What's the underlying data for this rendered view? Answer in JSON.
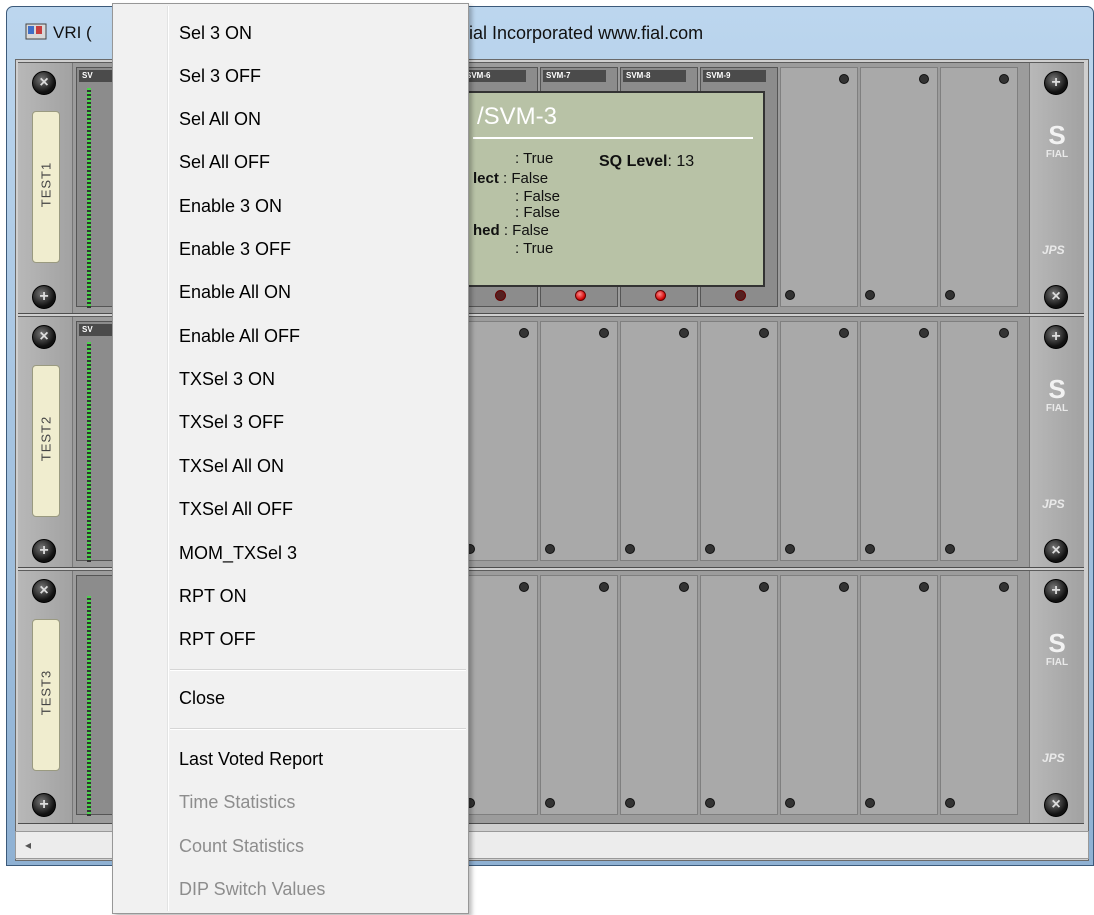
{
  "window": {
    "title_left": "VRI (",
    "title_right": "ial Incorporated   www.fial.com"
  },
  "racks": [
    {
      "label": "TEST1",
      "module_prefix": "SV"
    },
    {
      "label": "TEST2",
      "module_prefix": "SV"
    },
    {
      "label": "TEST3",
      "module_prefix": ""
    }
  ],
  "rack1_modules": [
    "SVM-6",
    "SVM-7",
    "SVM-8",
    "SVM-9"
  ],
  "brand": {
    "logo_text": "FIAL",
    "rail_logo": "JPS"
  },
  "tooltip": {
    "title": "/SVM-3",
    "sq_label": "SQ Level",
    "sq_value": ": 13",
    "lines": [
      {
        "key": "",
        "value": ": True"
      },
      {
        "key": "lect",
        "value": ": False"
      },
      {
        "key": "",
        "value": ": False"
      },
      {
        "key": "",
        "value": ": False"
      },
      {
        "key": "hed",
        "value": ": False"
      },
      {
        "key": "",
        "value": ": True"
      }
    ]
  },
  "scrollbar": {
    "left_arrow": "◂"
  },
  "menu": {
    "items": [
      {
        "label": "Sel 3 ON",
        "enabled": true
      },
      {
        "label": "Sel 3 OFF",
        "enabled": true
      },
      {
        "label": "Sel All ON",
        "enabled": true
      },
      {
        "label": "Sel All OFF",
        "enabled": true
      },
      {
        "label": "Enable 3 ON",
        "enabled": true
      },
      {
        "label": "Enable 3 OFF",
        "enabled": true
      },
      {
        "label": "Enable All ON",
        "enabled": true
      },
      {
        "label": "Enable All OFF",
        "enabled": true
      },
      {
        "label": "TXSel 3 ON",
        "enabled": true
      },
      {
        "label": "TXSel 3 OFF",
        "enabled": true
      },
      {
        "label": "TXSel All ON",
        "enabled": true
      },
      {
        "label": "TXSel All OFF",
        "enabled": true
      },
      {
        "label": "MOM_TXSel 3",
        "enabled": true
      },
      {
        "label": "RPT ON",
        "enabled": true
      },
      {
        "label": "RPT OFF",
        "enabled": true
      }
    ],
    "close": {
      "label": "Close",
      "enabled": true
    },
    "reports": [
      {
        "label": "Last Voted Report",
        "enabled": true
      },
      {
        "label": "Time Statistics",
        "enabled": false
      },
      {
        "label": "Count Statistics",
        "enabled": false
      },
      {
        "label": "DIP Switch Values",
        "enabled": false
      }
    ]
  }
}
